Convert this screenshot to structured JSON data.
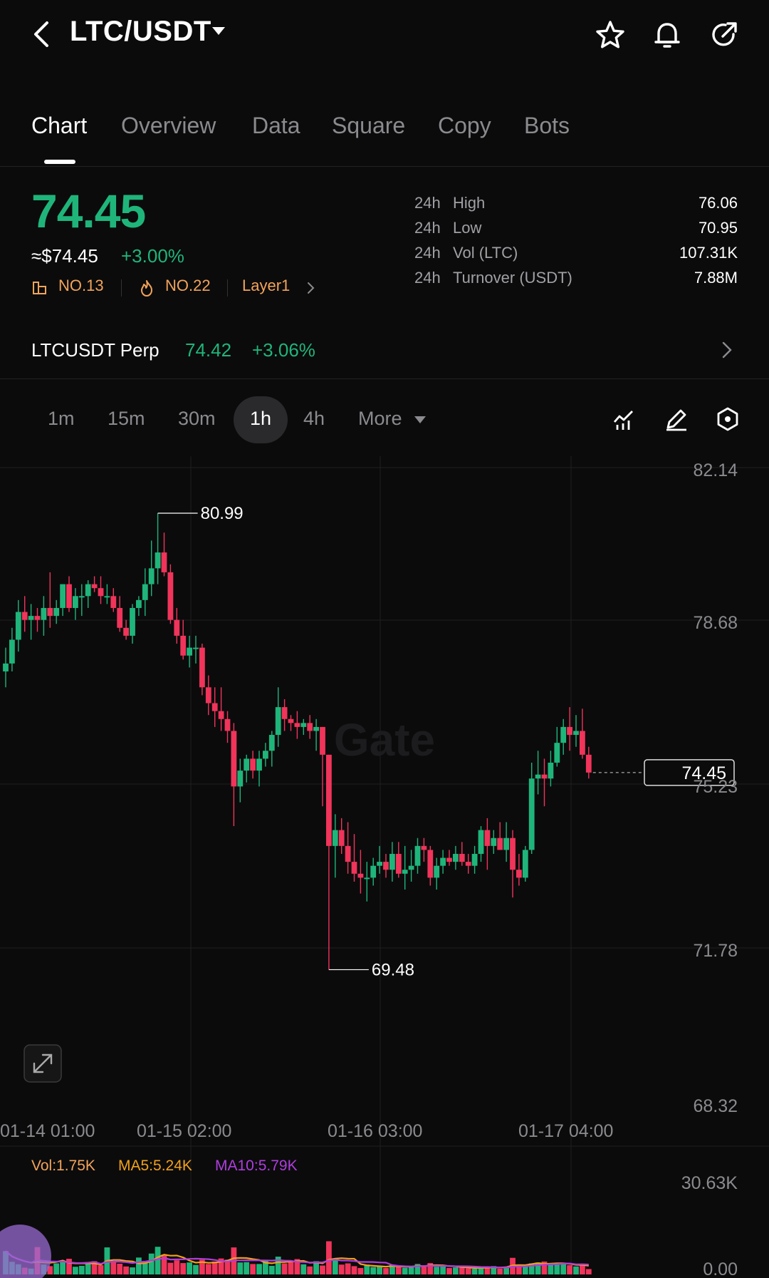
{
  "header": {
    "pair": "LTC/USDT"
  },
  "tabs": [
    {
      "label": "Chart"
    },
    {
      "label": "Overview"
    },
    {
      "label": "Data"
    },
    {
      "label": "Square"
    },
    {
      "label": "Copy"
    },
    {
      "label": "Bots"
    }
  ],
  "ticker": {
    "price": "74.45",
    "usd_price": "≈$74.45",
    "change": "+3.00%",
    "rank_tag": "NO.13",
    "hot_tag": "NO.22",
    "category_tag": "Layer1",
    "tag_color": "#f2a45a",
    "up_color": "#1fb57a",
    "down_color": "#f0345a"
  },
  "stats": [
    {
      "period": "24h",
      "label": "High",
      "value": "76.06"
    },
    {
      "period": "24h",
      "label": "Low",
      "value": "70.95"
    },
    {
      "period": "24h",
      "label": "Vol (LTC)",
      "value": "107.31K"
    },
    {
      "period": "24h",
      "label": "Turnover (USDT)",
      "value": "7.88M"
    }
  ],
  "perp": {
    "name": "LTCUSDT Perp",
    "price": "74.42",
    "change": "+3.06%"
  },
  "intervals": [
    {
      "label": "1m"
    },
    {
      "label": "15m"
    },
    {
      "label": "30m"
    },
    {
      "label": "1h",
      "active": true
    },
    {
      "label": "4h"
    },
    {
      "label": "More"
    }
  ],
  "chart_data": {
    "type": "candlestick",
    "watermark": "Gate",
    "y_ticks": [
      "82.14",
      "78.68",
      "75.23",
      "71.78",
      "68.32"
    ],
    "ylim": [
      68.32,
      82.14
    ],
    "x_ticks": [
      "01-14 01:00",
      "01-15 02:00",
      "01-16 03:00",
      "01-17 04:00"
    ],
    "current_price_label": "74.45",
    "high_marker": "80.99",
    "low_marker": "69.48",
    "candles": [
      [
        77.0,
        77.6,
        76.6,
        77.2
      ],
      [
        77.2,
        78.1,
        77.0,
        77.8
      ],
      [
        77.8,
        78.8,
        77.5,
        78.5
      ],
      [
        78.5,
        78.9,
        78.0,
        78.3
      ],
      [
        78.3,
        78.7,
        77.8,
        78.4
      ],
      [
        78.4,
        78.6,
        78.0,
        78.3
      ],
      [
        78.3,
        78.9,
        77.9,
        78.6
      ],
      [
        78.6,
        79.5,
        78.1,
        78.4
      ],
      [
        78.4,
        78.8,
        78.2,
        78.6
      ],
      [
        78.6,
        79.2,
        78.4,
        79.2
      ],
      [
        79.2,
        79.4,
        78.5,
        78.6
      ],
      [
        78.6,
        79.1,
        78.3,
        78.9
      ],
      [
        78.9,
        79.2,
        78.4,
        78.9
      ],
      [
        78.9,
        79.3,
        78.6,
        79.2
      ],
      [
        79.2,
        79.4,
        79.0,
        79.1
      ],
      [
        79.1,
        79.4,
        78.7,
        78.9
      ],
      [
        78.9,
        79.2,
        78.7,
        78.9
      ],
      [
        78.9,
        79.1,
        78.5,
        78.6
      ],
      [
        78.6,
        78.9,
        78.0,
        78.1
      ],
      [
        78.1,
        78.3,
        77.8,
        77.9
      ],
      [
        77.9,
        78.7,
        77.7,
        78.6
      ],
      [
        78.6,
        78.9,
        78.4,
        78.8
      ],
      [
        78.8,
        79.6,
        78.4,
        79.2
      ],
      [
        79.2,
        80.3,
        78.9,
        79.6
      ],
      [
        79.6,
        80.99,
        79.2,
        80.0
      ],
      [
        80.0,
        80.5,
        79.4,
        79.5
      ],
      [
        79.5,
        79.7,
        78.2,
        78.3
      ],
      [
        78.3,
        78.6,
        77.7,
        77.9
      ],
      [
        77.9,
        78.3,
        77.3,
        77.4
      ],
      [
        77.4,
        77.9,
        77.1,
        77.6
      ],
      [
        77.6,
        77.9,
        77.2,
        77.6
      ],
      [
        77.6,
        77.7,
        76.4,
        76.6
      ],
      [
        76.6,
        76.9,
        75.9,
        76.2
      ],
      [
        76.2,
        76.6,
        75.6,
        76.0
      ],
      [
        76.0,
        76.6,
        75.5,
        75.8
      ],
      [
        75.8,
        76.0,
        75.2,
        75.5
      ],
      [
        75.5,
        75.7,
        73.1,
        74.1
      ],
      [
        74.1,
        74.8,
        73.7,
        74.5
      ],
      [
        74.5,
        74.9,
        74.2,
        74.8
      ],
      [
        74.8,
        75.0,
        74.3,
        74.5
      ],
      [
        74.5,
        75.0,
        74.1,
        74.8
      ],
      [
        74.8,
        75.2,
        74.6,
        75.0
      ],
      [
        75.0,
        75.5,
        74.6,
        75.4
      ],
      [
        75.4,
        76.6,
        75.1,
        76.1
      ],
      [
        76.1,
        76.3,
        75.5,
        75.8
      ],
      [
        75.8,
        75.9,
        75.5,
        75.7
      ],
      [
        75.7,
        76.0,
        75.3,
        75.6
      ],
      [
        75.6,
        75.8,
        75.4,
        75.7
      ],
      [
        75.7,
        75.9,
        75.3,
        75.5
      ],
      [
        75.5,
        75.8,
        75.0,
        75.6
      ],
      [
        75.6,
        75.6,
        73.6,
        74.9
      ],
      [
        74.9,
        74.9,
        69.48,
        72.6
      ],
      [
        72.6,
        73.4,
        71.8,
        73.0
      ],
      [
        73.0,
        73.3,
        72.4,
        72.6
      ],
      [
        72.6,
        73.2,
        71.9,
        72.2
      ],
      [
        72.2,
        72.9,
        71.7,
        71.9
      ],
      [
        71.9,
        72.5,
        71.4,
        71.8
      ],
      [
        71.8,
        72.2,
        71.2,
        71.8
      ],
      [
        71.8,
        72.3,
        71.6,
        72.1
      ],
      [
        72.1,
        72.6,
        71.9,
        72.2
      ],
      [
        72.2,
        72.4,
        71.8,
        72.0
      ],
      [
        72.0,
        72.7,
        71.7,
        72.4
      ],
      [
        72.4,
        72.7,
        71.8,
        71.9
      ],
      [
        71.9,
        72.6,
        71.5,
        72.0
      ],
      [
        72.0,
        72.5,
        71.7,
        72.1
      ],
      [
        72.1,
        72.8,
        71.9,
        72.6
      ],
      [
        72.6,
        72.8,
        72.2,
        72.5
      ],
      [
        72.5,
        72.6,
        71.6,
        71.8
      ],
      [
        71.8,
        72.3,
        71.5,
        72.1
      ],
      [
        72.1,
        72.5,
        71.9,
        72.3
      ],
      [
        72.3,
        72.5,
        72.1,
        72.2
      ],
      [
        72.2,
        72.6,
        72.0,
        72.4
      ],
      [
        72.4,
        72.7,
        72.1,
        72.2
      ],
      [
        72.2,
        72.4,
        71.9,
        72.1
      ],
      [
        72.1,
        72.6,
        71.9,
        72.4
      ],
      [
        72.4,
        73.1,
        72.2,
        73.0
      ],
      [
        73.0,
        73.3,
        72.0,
        72.6
      ],
      [
        72.6,
        73.0,
        72.4,
        72.8
      ],
      [
        72.8,
        73.2,
        72.5,
        72.5
      ],
      [
        72.5,
        73.2,
        72.2,
        72.8
      ],
      [
        72.8,
        73.0,
        71.3,
        72.0
      ],
      [
        72.0,
        72.4,
        71.6,
        71.8
      ],
      [
        71.8,
        72.6,
        71.7,
        72.5
      ],
      [
        72.5,
        74.7,
        72.4,
        74.3
      ],
      [
        74.3,
        75.0,
        73.9,
        74.4
      ],
      [
        74.4,
        74.8,
        73.6,
        74.3
      ],
      [
        74.3,
        75.0,
        74.1,
        74.7
      ],
      [
        74.7,
        75.6,
        74.6,
        75.2
      ],
      [
        75.2,
        75.8,
        74.9,
        75.6
      ],
      [
        75.6,
        76.1,
        75.0,
        75.4
      ],
      [
        75.4,
        75.9,
        75.1,
        75.5
      ],
      [
        75.5,
        76.06,
        74.8,
        74.9
      ],
      [
        74.9,
        75.1,
        74.3,
        74.45
      ]
    ]
  },
  "volume": {
    "vol_label": "Vol:1.75K",
    "ma5_label": "MA5:5.24K",
    "ma10_label": "MA10:5.79K",
    "max_label": "30.63K",
    "min_label": "0.00",
    "ma5_color": "#f2a11a",
    "ma10_color": "#b03dde",
    "max": 30.63,
    "values": [
      7.6,
      4.1,
      3.3,
      2.2,
      1.9,
      8.9,
      3.2,
      2.7,
      3.6,
      4.2,
      5.1,
      2.5,
      2.8,
      3.4,
      4.3,
      3.0,
      8.8,
      4.0,
      3.5,
      2.6,
      2.3,
      5.5,
      4.4,
      6.8,
      9.0,
      6.5,
      3.8,
      4.6,
      3.7,
      3.9,
      3.1,
      4.8,
      3.4,
      4.2,
      5.2,
      4.8,
      8.8,
      3.9,
      4.0,
      3.4,
      3.4,
      4.5,
      2.8,
      5.8,
      3.6,
      4.4,
      5.0,
      3.3,
      2.6,
      4.3,
      2.9,
      10.8,
      5.2,
      3.2,
      3.6,
      2.7,
      2.1,
      3.2,
      2.4,
      2.9,
      2.1,
      3.1,
      2.5,
      2.2,
      2.8,
      3.4,
      2.7,
      3.7,
      2.5,
      2.6,
      2.1,
      2.3,
      2.3,
      2.0,
      1.9,
      2.2,
      2.6,
      2.7,
      1.9,
      2.3,
      5.4,
      2.9,
      2.6,
      3.6,
      3.9,
      4.2,
      3.3,
      3.2,
      3.6,
      3.0,
      2.6,
      3.2,
      1.75
    ]
  }
}
